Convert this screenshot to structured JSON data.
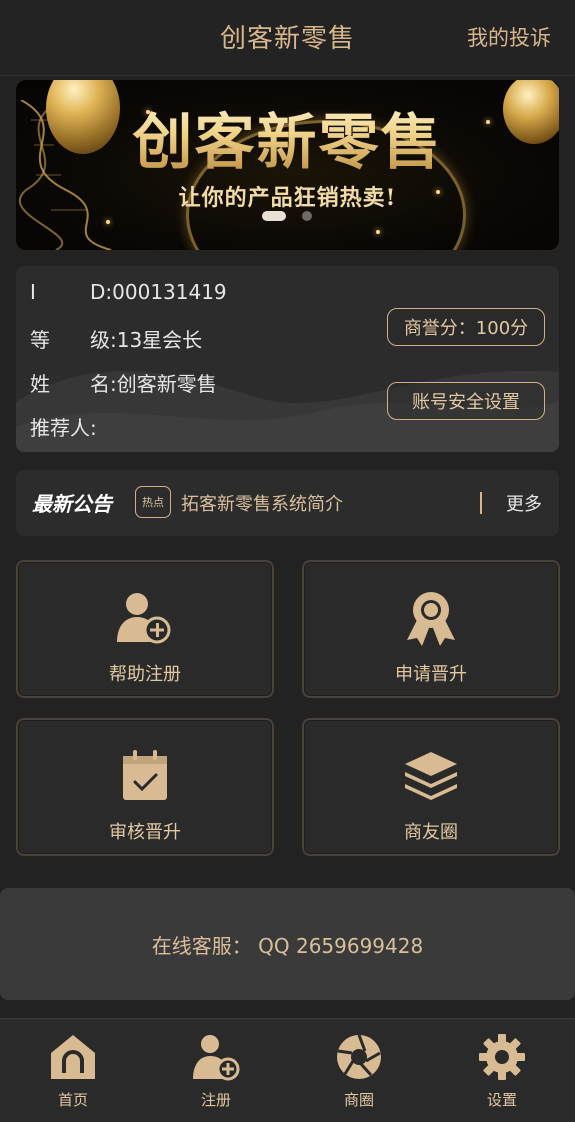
{
  "header": {
    "title": "创客新零售",
    "complaint_link": "我的投诉"
  },
  "banner": {
    "title": "创客新零售",
    "slogan": "让你的产品狂销热卖!",
    "active_slide": 1,
    "slide_count": 2
  },
  "profile": {
    "id_label": "I",
    "id_value": "D:000131419",
    "level_label": "等",
    "level_value": "级:13星会长",
    "name_label": "姓",
    "name_value": "名:创客新零售",
    "referrer_label": "推荐人:",
    "referrer_value": "",
    "reputation_button": "商誉分：100分",
    "security_button": "账号安全设置"
  },
  "notice": {
    "label": "最新公告",
    "hot_badge": "热点",
    "text": "拓客新零售系统简介",
    "more": "更多"
  },
  "actions": [
    {
      "label": "帮助注册",
      "icon": "add-user-icon"
    },
    {
      "label": "申请晋升",
      "icon": "award-ribbon-icon"
    },
    {
      "label": "审核晋升",
      "icon": "calendar-check-icon"
    },
    {
      "label": "商友圈",
      "icon": "layers-icon"
    }
  ],
  "service": {
    "text": "在线客服： QQ 2659699428"
  },
  "tabbar": [
    {
      "label": "首页",
      "icon": "home-icon"
    },
    {
      "label": "注册",
      "icon": "add-user-icon"
    },
    {
      "label": "商圈",
      "icon": "aperture-icon"
    },
    {
      "label": "设置",
      "icon": "gear-icon"
    }
  ],
  "colors": {
    "background": "#222222",
    "card": "#2c2c2c",
    "accent_gold": "#d1b187",
    "text_gold": "#e2c8a2"
  }
}
